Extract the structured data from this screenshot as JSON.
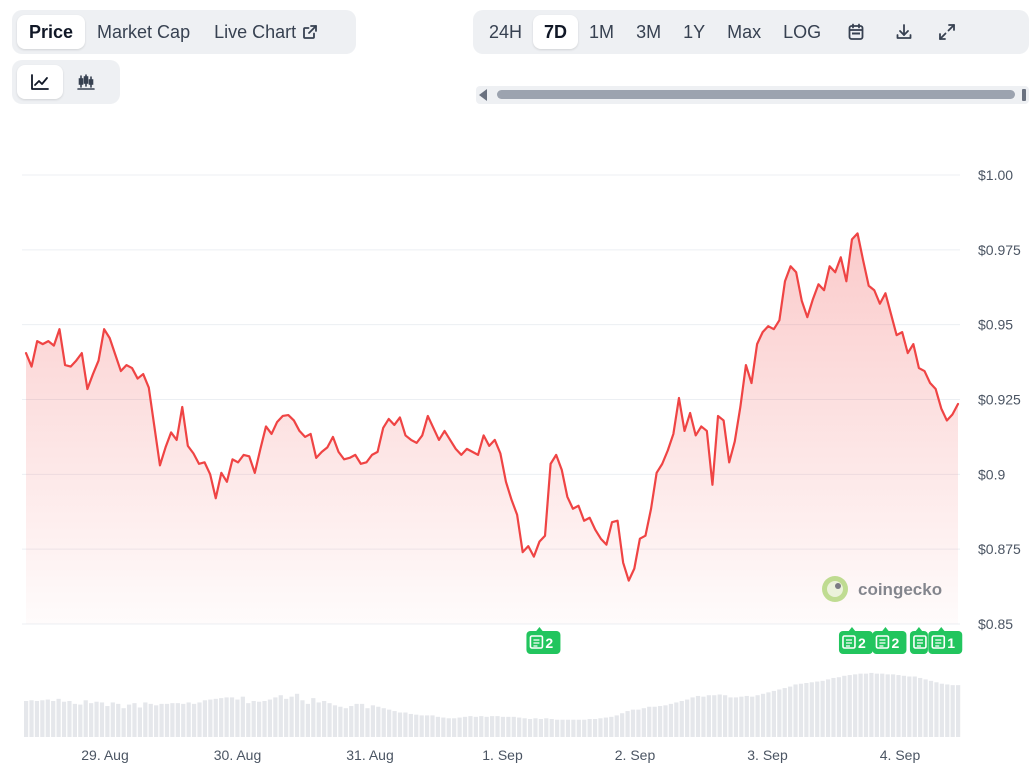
{
  "toolbar": {
    "metric_tabs": [
      {
        "label": "Price",
        "active": true
      },
      {
        "label": "Market Cap",
        "active": false
      },
      {
        "label": "Live Chart",
        "active": false,
        "icon": "external-link-icon"
      }
    ],
    "chart_types": [
      {
        "icon": "line-chart-icon",
        "active": true
      },
      {
        "icon": "candlestick-icon",
        "active": false
      }
    ],
    "ranges": [
      {
        "label": "24H",
        "active": false
      },
      {
        "label": "7D",
        "active": true
      },
      {
        "label": "1M",
        "active": false
      },
      {
        "label": "3M",
        "active": false
      },
      {
        "label": "1Y",
        "active": false
      },
      {
        "label": "Max",
        "active": false
      },
      {
        "label": "LOG",
        "active": false
      }
    ],
    "tools": [
      "calendar-icon",
      "download-icon",
      "expand-icon"
    ]
  },
  "chart_data": {
    "type": "area",
    "xlabel": "",
    "ylabel": "",
    "x_ticks": [
      "29. Aug",
      "30. Aug",
      "31. Aug",
      "1. Sep",
      "2. Sep",
      "3. Sep",
      "4. Sep"
    ],
    "y_ticks": [
      "$1.00",
      "$0.975",
      "$0.95",
      "$0.925",
      "$0.9",
      "$0.875",
      "$0.85"
    ],
    "ylim": [
      0.85,
      1.0
    ],
    "grid": true,
    "colors": {
      "line": "#ef4444",
      "volume": "#e5e7eb",
      "news": "#22c55e",
      "grid": "#eceff3"
    },
    "series": [
      {
        "x_start": "28. Aug 10:30",
        "interval_hours": 1,
        "values": [
          0.9405,
          0.936,
          0.9445,
          0.9435,
          0.9445,
          0.943,
          0.9485,
          0.9365,
          0.936,
          0.938,
          0.9405,
          0.9285,
          0.9335,
          0.938,
          0.9485,
          0.9455,
          0.94,
          0.9345,
          0.9365,
          0.9355,
          0.932,
          0.9335,
          0.929,
          0.916,
          0.903,
          0.909,
          0.914,
          0.9115,
          0.9225,
          0.9095,
          0.907,
          0.9035,
          0.904,
          0.9,
          0.892,
          0.9005,
          0.8975,
          0.905,
          0.904,
          0.9065,
          0.906,
          0.9005,
          0.9085,
          0.916,
          0.9135,
          0.9175,
          0.9195,
          0.9198,
          0.918,
          0.9145,
          0.9125,
          0.9135,
          0.9055,
          0.9075,
          0.909,
          0.9125,
          0.9075,
          0.905,
          0.9055,
          0.9065,
          0.9035,
          0.904,
          0.9065,
          0.9075,
          0.9155,
          0.9185,
          0.9165,
          0.919,
          0.913,
          0.9115,
          0.9105,
          0.913,
          0.9195,
          0.9155,
          0.9115,
          0.9145,
          0.9115,
          0.9085,
          0.9065,
          0.9085,
          0.9075,
          0.9065,
          0.913,
          0.9095,
          0.9115,
          0.907,
          0.8975,
          0.8915,
          0.8865,
          0.874,
          0.876,
          0.8725,
          0.8775,
          0.8795,
          0.9035,
          0.9065,
          0.9015,
          0.8925,
          0.8885,
          0.8895,
          0.8845,
          0.8855,
          0.8815,
          0.8785,
          0.8765,
          0.884,
          0.8845,
          0.8705,
          0.8645,
          0.8685,
          0.8785,
          0.8795,
          0.8885,
          0.9005,
          0.9035,
          0.908,
          0.9135,
          0.9255,
          0.9145,
          0.9205,
          0.913,
          0.916,
          0.9145,
          0.8965,
          0.9195,
          0.918,
          0.904,
          0.911,
          0.9225,
          0.9365,
          0.9305,
          0.9435,
          0.9475,
          0.9495,
          0.9485,
          0.9515,
          0.9645,
          0.9695,
          0.9675,
          0.958,
          0.9525,
          0.9585,
          0.9635,
          0.9615,
          0.9695,
          0.9675,
          0.9725,
          0.9645,
          0.9785,
          0.9805,
          0.9715,
          0.963,
          0.9615,
          0.957,
          0.9605,
          0.9535,
          0.9465,
          0.9475,
          0.9405,
          0.9435,
          0.9355,
          0.9345,
          0.9305,
          0.9285,
          0.922,
          0.918,
          0.92,
          0.9235
        ]
      }
    ],
    "volume": {
      "values": [
        0.5,
        0.51,
        0.5,
        0.51,
        0.52,
        0.5,
        0.53,
        0.49,
        0.5,
        0.46,
        0.45,
        0.51,
        0.47,
        0.49,
        0.48,
        0.43,
        0.48,
        0.46,
        0.4,
        0.45,
        0.47,
        0.41,
        0.48,
        0.46,
        0.44,
        0.46,
        0.46,
        0.47,
        0.47,
        0.46,
        0.48,
        0.46,
        0.48,
        0.51,
        0.52,
        0.53,
        0.54,
        0.55,
        0.55,
        0.52,
        0.56,
        0.47,
        0.5,
        0.49,
        0.5,
        0.52,
        0.55,
        0.58,
        0.53,
        0.56,
        0.6,
        0.51,
        0.46,
        0.54,
        0.48,
        0.5,
        0.47,
        0.44,
        0.42,
        0.4,
        0.43,
        0.46,
        0.46,
        0.4,
        0.44,
        0.42,
        0.4,
        0.38,
        0.36,
        0.34,
        0.34,
        0.32,
        0.31,
        0.3,
        0.3,
        0.3,
        0.28,
        0.27,
        0.26,
        0.26,
        0.27,
        0.28,
        0.29,
        0.28,
        0.29,
        0.28,
        0.29,
        0.29,
        0.28,
        0.28,
        0.28,
        0.27,
        0.26,
        0.25,
        0.26,
        0.25,
        0.26,
        0.25,
        0.24,
        0.24,
        0.24,
        0.24,
        0.24,
        0.24,
        0.25,
        0.25,
        0.26,
        0.27,
        0.28,
        0.3,
        0.33,
        0.36,
        0.38,
        0.38,
        0.4,
        0.42,
        0.42,
        0.43,
        0.44,
        0.46,
        0.48,
        0.5,
        0.52,
        0.55,
        0.57,
        0.56,
        0.58,
        0.58,
        0.59,
        0.58,
        0.55,
        0.55,
        0.56,
        0.57,
        0.56,
        0.58,
        0.6,
        0.62,
        0.64,
        0.66,
        0.68,
        0.7,
        0.73,
        0.74,
        0.75,
        0.76,
        0.77,
        0.78,
        0.8,
        0.82,
        0.83,
        0.85,
        0.86,
        0.87,
        0.88,
        0.88,
        0.89,
        0.88,
        0.88,
        0.87,
        0.87,
        0.86,
        0.85,
        0.84,
        0.84,
        0.82,
        0.8,
        0.78,
        0.76,
        0.74,
        0.73,
        0.72,
        0.72
      ]
    },
    "news_markers": [
      {
        "count": "2",
        "time_index": 92
      },
      {
        "count": "2",
        "time_index": 148
      },
      {
        "count": "2",
        "time_index": 154
      },
      {
        "count": "",
        "time_index": 160
      },
      {
        "count": "1",
        "time_index": 164
      }
    ],
    "watermark": "coingecko"
  }
}
